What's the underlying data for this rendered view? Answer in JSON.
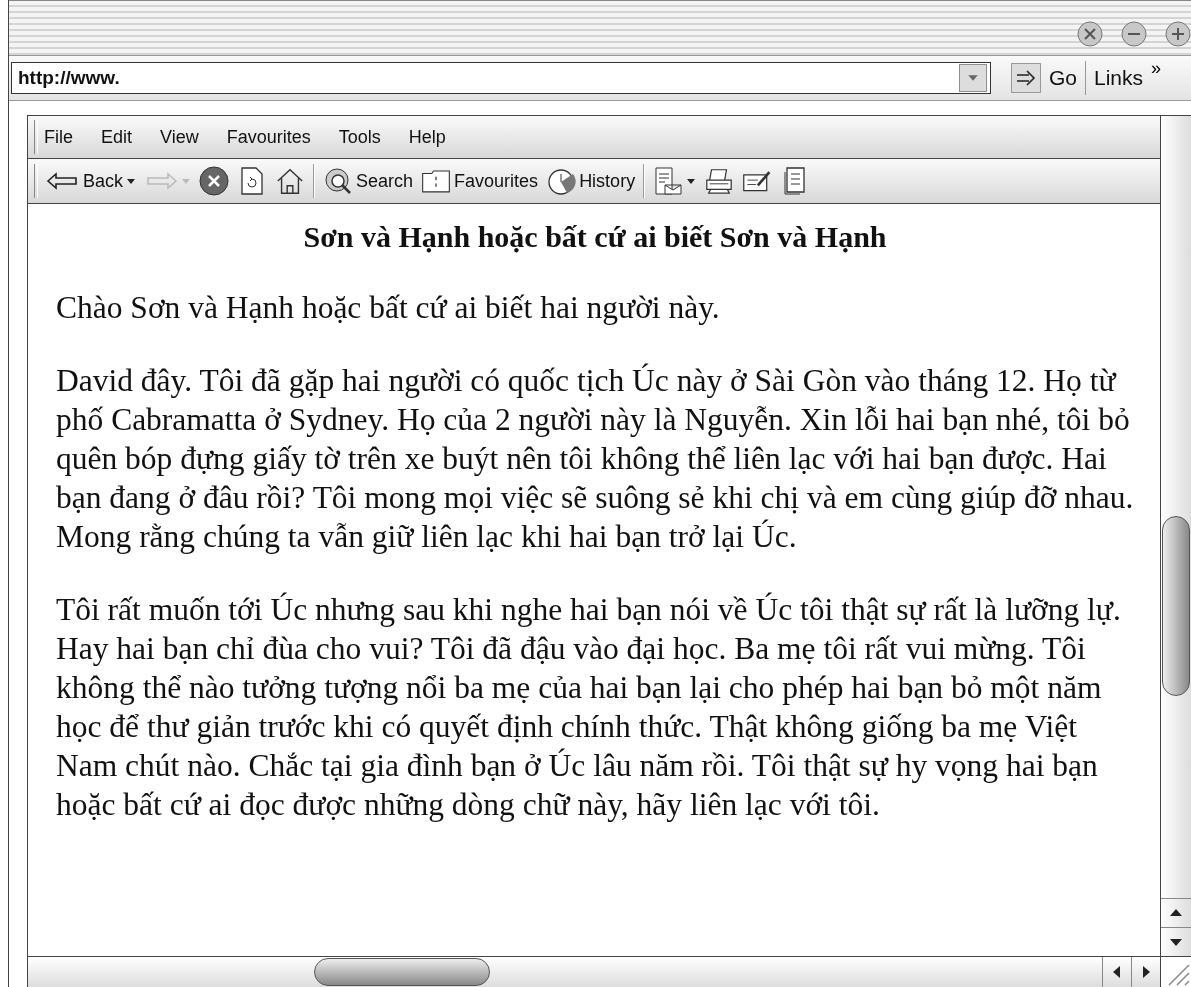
{
  "address_bar": {
    "value": "http://www.",
    "go_label": "Go",
    "links_label": "Links",
    "links_more": "»"
  },
  "menu": [
    "File",
    "Edit",
    "View",
    "Favourites",
    "Tools",
    "Help"
  ],
  "toolbar": {
    "back": {
      "label": "Back"
    },
    "forward": {
      "disabled": true
    },
    "search": {
      "label": "Search"
    },
    "favourites": {
      "label": "Favourites"
    },
    "history": {
      "label": "History"
    }
  },
  "page": {
    "title": "Sơn và Hạnh hoặc bất cứ ai biết Sơn và Hạnh",
    "paragraphs": [
      "Chào Sơn và Hạnh hoặc bất cứ ai biết hai người này.",
      "David đây. Tôi đã gặp hai người có quốc tịch Úc này ở Sài Gòn vào tháng 12. Họ từ phố Cabramatta ở Sydney. Họ của 2 người này là Nguyễn. Xin lỗi hai bạn nhé, tôi bỏ quên bóp đựng giấy tờ trên xe buýt nên tôi không thể liên lạc với hai bạn được. Hai bạn đang ở đâu rồi? Tôi mong mọi việc sẽ suông sẻ khi chị và em cùng giúp đỡ nhau. Mong rằng chúng ta vẫn giữ liên lạc khi hai bạn trở lại Úc.",
      "Tôi rất muốn tới Úc nhưng sau khi nghe hai bạn nói về Úc tôi thật sự rất là lưỡng lự. Hay hai bạn chỉ đùa cho vui? Tôi đã đậu vào đại học. Ba mẹ tôi rất vui mừng. Tôi không thể nào tưởng tượng nổi ba mẹ của hai bạn lại cho phép hai bạn bỏ một năm học để thư giản trước khi có quyết định chính thức. Thật không giống ba mẹ Việt Nam chút nào. Chắc tại gia đình bạn ở Úc lâu năm rồi. Tôi thật sự hy vọng hai bạn hoặc bất cứ ai đọc được những dòng chữ này, hãy liên lạc với tôi."
    ]
  }
}
